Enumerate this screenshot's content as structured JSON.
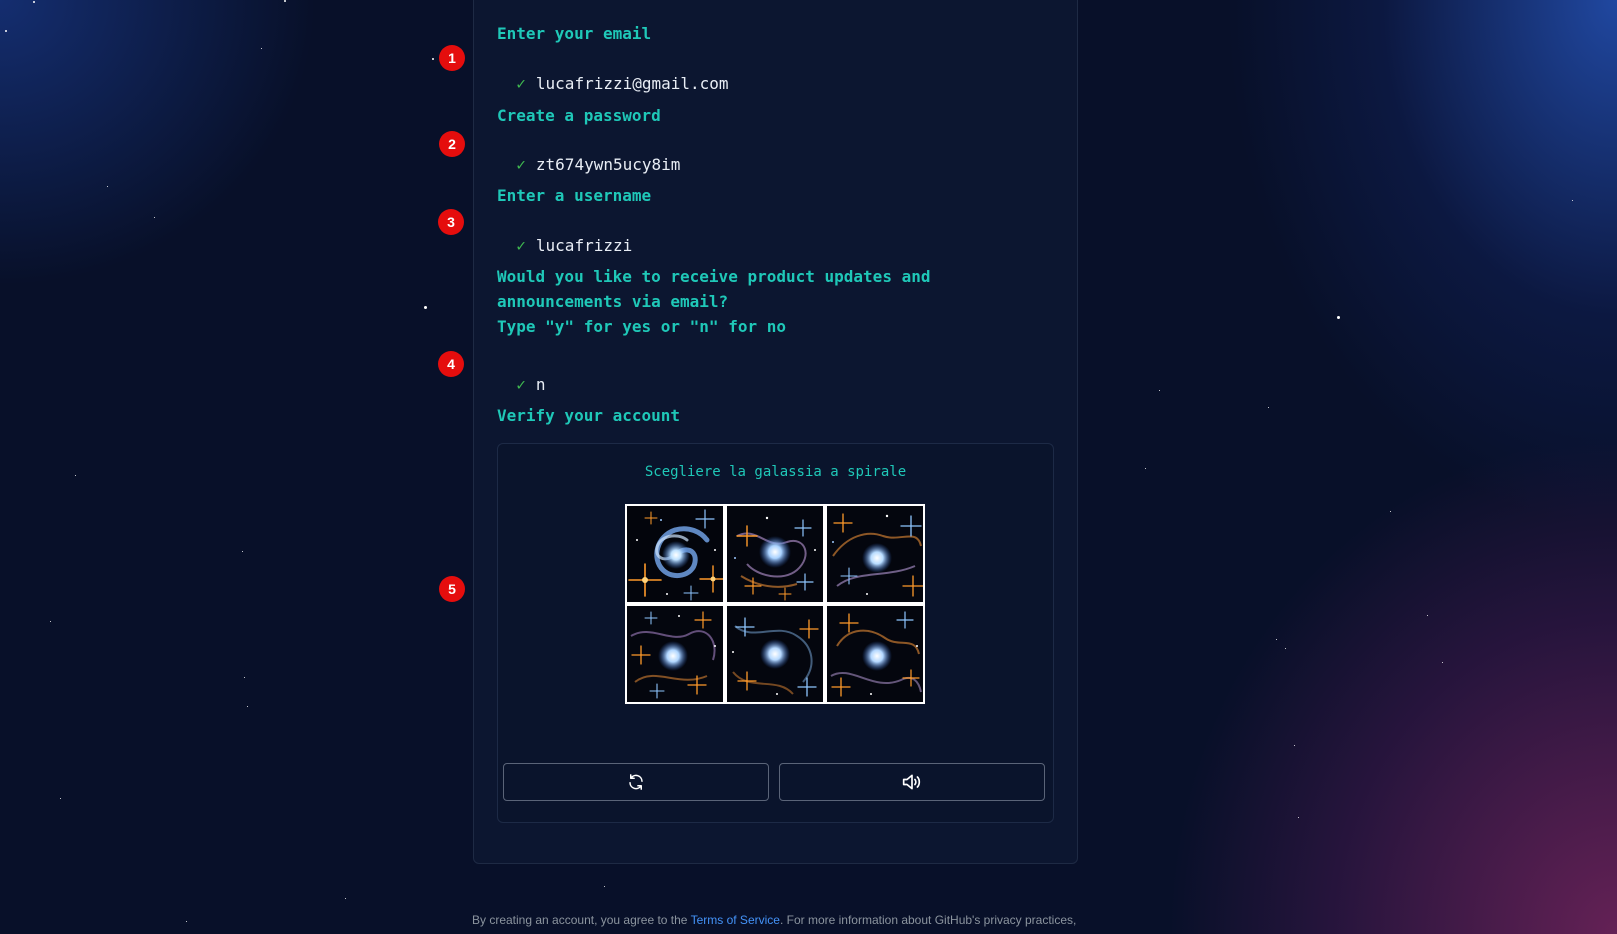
{
  "steps": {
    "email": {
      "number": "1",
      "prompt": "Enter your email",
      "check": "✓",
      "value": "lucafrizzi@gmail.com"
    },
    "password": {
      "number": "2",
      "prompt": "Create a password",
      "check": "✓",
      "value": "zt674ywn5ucy8im"
    },
    "username": {
      "number": "3",
      "prompt": "Enter a username",
      "check": "✓",
      "value": "lucafrizzi"
    },
    "updates": {
      "number": "4",
      "prompt_line1": "Would you like to receive product updates and",
      "prompt_line2": "announcements via email?",
      "prompt_line3": "Type \"y\" for yes or \"n\" for no",
      "check": "✓",
      "value": "n"
    },
    "verify": {
      "number": "5",
      "prompt": "Verify your account"
    }
  },
  "captcha": {
    "instruction": "Scegliere la galassia a spirale",
    "tiles": [
      {
        "icon": "spiral-galaxy-image"
      },
      {
        "icon": "star-cluster-image"
      },
      {
        "icon": "star-cluster-image"
      },
      {
        "icon": "star-cluster-image"
      },
      {
        "icon": "star-cluster-image"
      },
      {
        "icon": "star-cluster-image"
      }
    ],
    "refresh_icon": "refresh-icon",
    "audio_icon": "speaker-audio-icon"
  },
  "footer": {
    "text_before": "By creating an account, you agree to the ",
    "terms_link": "Terms of Service",
    "text_after": ". For more information about GitHub's privacy practices,"
  },
  "colors": {
    "prompt": "#1fc8b8",
    "check": "#3fb950",
    "badge": "#e50d0d",
    "link": "#4493f8",
    "background": "#081029"
  }
}
